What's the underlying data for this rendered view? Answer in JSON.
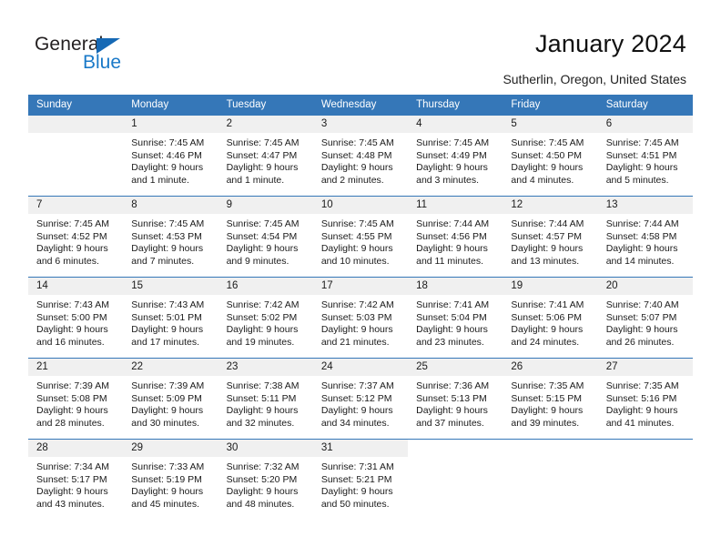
{
  "logo": {
    "word_top": "General",
    "word_bottom": "Blue",
    "triangle_icon": "triangle-icon",
    "color_dark": "#231f20",
    "color_blue": "#1a79c8"
  },
  "header": {
    "title": "January 2024",
    "subtitle": "Sutherlin, Oregon, United States"
  },
  "theme": {
    "header_blue": "#3577b8",
    "daynum_band": "#f0f0f0",
    "cell_background": "#ffffff"
  },
  "calendar": {
    "weekday_headers": [
      "Sunday",
      "Monday",
      "Tuesday",
      "Wednesday",
      "Thursday",
      "Friday",
      "Saturday"
    ],
    "weeks": [
      [
        {
          "day": "",
          "sunrise": "",
          "sunset": "",
          "daylight_line1": "",
          "daylight_line2": "",
          "empty": true
        },
        {
          "day": "1",
          "sunrise": "Sunrise: 7:45 AM",
          "sunset": "Sunset: 4:46 PM",
          "daylight_line1": "Daylight: 9 hours",
          "daylight_line2": "and 1 minute."
        },
        {
          "day": "2",
          "sunrise": "Sunrise: 7:45 AM",
          "sunset": "Sunset: 4:47 PM",
          "daylight_line1": "Daylight: 9 hours",
          "daylight_line2": "and 1 minute."
        },
        {
          "day": "3",
          "sunrise": "Sunrise: 7:45 AM",
          "sunset": "Sunset: 4:48 PM",
          "daylight_line1": "Daylight: 9 hours",
          "daylight_line2": "and 2 minutes."
        },
        {
          "day": "4",
          "sunrise": "Sunrise: 7:45 AM",
          "sunset": "Sunset: 4:49 PM",
          "daylight_line1": "Daylight: 9 hours",
          "daylight_line2": "and 3 minutes."
        },
        {
          "day": "5",
          "sunrise": "Sunrise: 7:45 AM",
          "sunset": "Sunset: 4:50 PM",
          "daylight_line1": "Daylight: 9 hours",
          "daylight_line2": "and 4 minutes."
        },
        {
          "day": "6",
          "sunrise": "Sunrise: 7:45 AM",
          "sunset": "Sunset: 4:51 PM",
          "daylight_line1": "Daylight: 9 hours",
          "daylight_line2": "and 5 minutes."
        }
      ],
      [
        {
          "day": "7",
          "sunrise": "Sunrise: 7:45 AM",
          "sunset": "Sunset: 4:52 PM",
          "daylight_line1": "Daylight: 9 hours",
          "daylight_line2": "and 6 minutes."
        },
        {
          "day": "8",
          "sunrise": "Sunrise: 7:45 AM",
          "sunset": "Sunset: 4:53 PM",
          "daylight_line1": "Daylight: 9 hours",
          "daylight_line2": "and 7 minutes."
        },
        {
          "day": "9",
          "sunrise": "Sunrise: 7:45 AM",
          "sunset": "Sunset: 4:54 PM",
          "daylight_line1": "Daylight: 9 hours",
          "daylight_line2": "and 9 minutes."
        },
        {
          "day": "10",
          "sunrise": "Sunrise: 7:45 AM",
          "sunset": "Sunset: 4:55 PM",
          "daylight_line1": "Daylight: 9 hours",
          "daylight_line2": "and 10 minutes."
        },
        {
          "day": "11",
          "sunrise": "Sunrise: 7:44 AM",
          "sunset": "Sunset: 4:56 PM",
          "daylight_line1": "Daylight: 9 hours",
          "daylight_line2": "and 11 minutes."
        },
        {
          "day": "12",
          "sunrise": "Sunrise: 7:44 AM",
          "sunset": "Sunset: 4:57 PM",
          "daylight_line1": "Daylight: 9 hours",
          "daylight_line2": "and 13 minutes."
        },
        {
          "day": "13",
          "sunrise": "Sunrise: 7:44 AM",
          "sunset": "Sunset: 4:58 PM",
          "daylight_line1": "Daylight: 9 hours",
          "daylight_line2": "and 14 minutes."
        }
      ],
      [
        {
          "day": "14",
          "sunrise": "Sunrise: 7:43 AM",
          "sunset": "Sunset: 5:00 PM",
          "daylight_line1": "Daylight: 9 hours",
          "daylight_line2": "and 16 minutes."
        },
        {
          "day": "15",
          "sunrise": "Sunrise: 7:43 AM",
          "sunset": "Sunset: 5:01 PM",
          "daylight_line1": "Daylight: 9 hours",
          "daylight_line2": "and 17 minutes."
        },
        {
          "day": "16",
          "sunrise": "Sunrise: 7:42 AM",
          "sunset": "Sunset: 5:02 PM",
          "daylight_line1": "Daylight: 9 hours",
          "daylight_line2": "and 19 minutes."
        },
        {
          "day": "17",
          "sunrise": "Sunrise: 7:42 AM",
          "sunset": "Sunset: 5:03 PM",
          "daylight_line1": "Daylight: 9 hours",
          "daylight_line2": "and 21 minutes."
        },
        {
          "day": "18",
          "sunrise": "Sunrise: 7:41 AM",
          "sunset": "Sunset: 5:04 PM",
          "daylight_line1": "Daylight: 9 hours",
          "daylight_line2": "and 23 minutes."
        },
        {
          "day": "19",
          "sunrise": "Sunrise: 7:41 AM",
          "sunset": "Sunset: 5:06 PM",
          "daylight_line1": "Daylight: 9 hours",
          "daylight_line2": "and 24 minutes."
        },
        {
          "day": "20",
          "sunrise": "Sunrise: 7:40 AM",
          "sunset": "Sunset: 5:07 PM",
          "daylight_line1": "Daylight: 9 hours",
          "daylight_line2": "and 26 minutes."
        }
      ],
      [
        {
          "day": "21",
          "sunrise": "Sunrise: 7:39 AM",
          "sunset": "Sunset: 5:08 PM",
          "daylight_line1": "Daylight: 9 hours",
          "daylight_line2": "and 28 minutes."
        },
        {
          "day": "22",
          "sunrise": "Sunrise: 7:39 AM",
          "sunset": "Sunset: 5:09 PM",
          "daylight_line1": "Daylight: 9 hours",
          "daylight_line2": "and 30 minutes."
        },
        {
          "day": "23",
          "sunrise": "Sunrise: 7:38 AM",
          "sunset": "Sunset: 5:11 PM",
          "daylight_line1": "Daylight: 9 hours",
          "daylight_line2": "and 32 minutes."
        },
        {
          "day": "24",
          "sunrise": "Sunrise: 7:37 AM",
          "sunset": "Sunset: 5:12 PM",
          "daylight_line1": "Daylight: 9 hours",
          "daylight_line2": "and 34 minutes."
        },
        {
          "day": "25",
          "sunrise": "Sunrise: 7:36 AM",
          "sunset": "Sunset: 5:13 PM",
          "daylight_line1": "Daylight: 9 hours",
          "daylight_line2": "and 37 minutes."
        },
        {
          "day": "26",
          "sunrise": "Sunrise: 7:35 AM",
          "sunset": "Sunset: 5:15 PM",
          "daylight_line1": "Daylight: 9 hours",
          "daylight_line2": "and 39 minutes."
        },
        {
          "day": "27",
          "sunrise": "Sunrise: 7:35 AM",
          "sunset": "Sunset: 5:16 PM",
          "daylight_line1": "Daylight: 9 hours",
          "daylight_line2": "and 41 minutes."
        }
      ],
      [
        {
          "day": "28",
          "sunrise": "Sunrise: 7:34 AM",
          "sunset": "Sunset: 5:17 PM",
          "daylight_line1": "Daylight: 9 hours",
          "daylight_line2": "and 43 minutes."
        },
        {
          "day": "29",
          "sunrise": "Sunrise: 7:33 AM",
          "sunset": "Sunset: 5:19 PM",
          "daylight_line1": "Daylight: 9 hours",
          "daylight_line2": "and 45 minutes."
        },
        {
          "day": "30",
          "sunrise": "Sunrise: 7:32 AM",
          "sunset": "Sunset: 5:20 PM",
          "daylight_line1": "Daylight: 9 hours",
          "daylight_line2": "and 48 minutes."
        },
        {
          "day": "31",
          "sunrise": "Sunrise: 7:31 AM",
          "sunset": "Sunset: 5:21 PM",
          "daylight_line1": "Daylight: 9 hours",
          "daylight_line2": "and 50 minutes."
        },
        {
          "day": "",
          "sunrise": "",
          "sunset": "",
          "daylight_line1": "",
          "daylight_line2": "",
          "empty": true,
          "blank": true
        },
        {
          "day": "",
          "sunrise": "",
          "sunset": "",
          "daylight_line1": "",
          "daylight_line2": "",
          "empty": true,
          "blank": true
        },
        {
          "day": "",
          "sunrise": "",
          "sunset": "",
          "daylight_line1": "",
          "daylight_line2": "",
          "empty": true,
          "blank": true
        }
      ]
    ]
  }
}
